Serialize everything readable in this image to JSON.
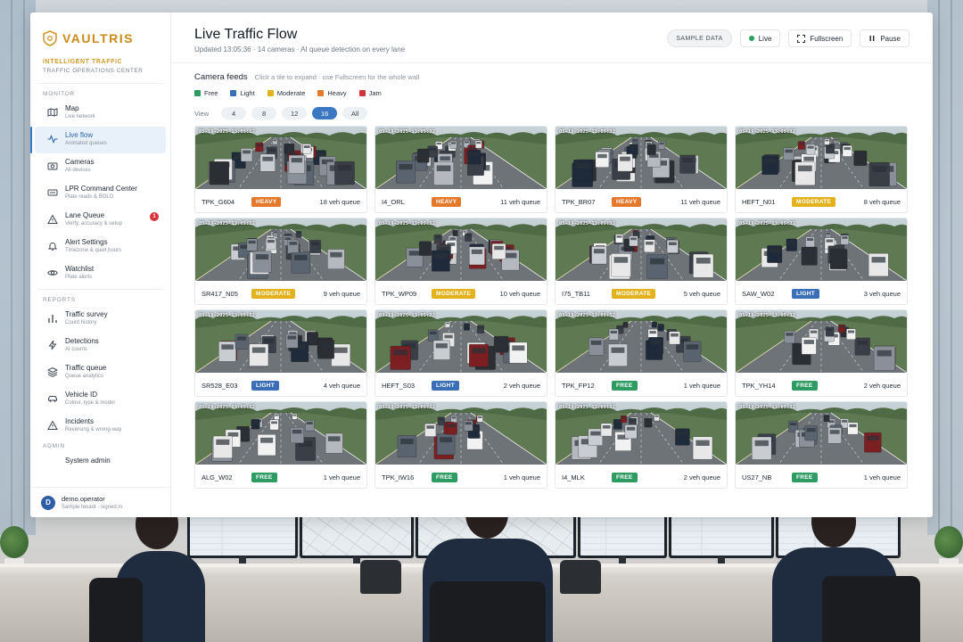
{
  "brand": {
    "name": "VAULTRIS",
    "org_line1": "INTELLIGENT TRAFFIC",
    "org_line2": "TRAFFIC OPERATIONS CENTER"
  },
  "nav": {
    "monitor_title": "MONITOR",
    "monitor": [
      {
        "label": "Map",
        "sub": "Live network",
        "icon": "map-icon"
      },
      {
        "label": "Live flow",
        "sub": "Animated queues",
        "icon": "pulse-icon",
        "active": true
      },
      {
        "label": "Cameras",
        "sub": "All devices",
        "icon": "camera-icon"
      },
      {
        "label": "LPR Command Center",
        "sub": "Plate reads & BOLO",
        "icon": "plate-icon"
      },
      {
        "label": "Lane Queue",
        "sub": "Verify, accuracy & setup",
        "icon": "warning-icon",
        "badge": "1"
      },
      {
        "label": "Alert Settings",
        "sub": "Timezone & quiet hours",
        "icon": "bell-icon"
      },
      {
        "label": "Watchlist",
        "sub": "Plate alerts",
        "icon": "eye-icon"
      }
    ],
    "reports_title": "REPORTS",
    "reports": [
      {
        "label": "Traffic survey",
        "sub": "Count history",
        "icon": "bar-chart-icon"
      },
      {
        "label": "Detections",
        "sub": "AI counts",
        "icon": "bolt-icon"
      },
      {
        "label": "Traffic queue",
        "sub": "Queue analytics",
        "icon": "layers-icon"
      },
      {
        "label": "Vehicle ID",
        "sub": "Colour, type & model",
        "icon": "car-icon"
      },
      {
        "label": "Incidents",
        "sub": "Reversing & wrong-way",
        "icon": "alert-icon"
      }
    ],
    "admin_title": "ADMIN",
    "admin": [
      {
        "label": "System admin",
        "icon": "gear-icon"
      }
    ]
  },
  "user": {
    "initial": "D",
    "name": "demo.operator",
    "sub": "Sample tenant · signed in"
  },
  "header": {
    "title": "Live Traffic Flow",
    "subtitle": "Updated 13:05:36 · 14 cameras · AI queue detection on every lane",
    "sample_label": "SAMPLE DATA",
    "live_label": "Live",
    "fullscreen_label": "Fullscreen",
    "pause_label": "Pause"
  },
  "feeds": {
    "title": "Camera feeds",
    "hint": "Click a tile to expand · use Fullscreen for the whole wall",
    "legend": [
      {
        "label": "Free",
        "color": "#2e9b63"
      },
      {
        "label": "Light",
        "color": "#3a6fb8"
      },
      {
        "label": "Moderate",
        "color": "#e4b21d"
      },
      {
        "label": "Heavy",
        "color": "#e5792b"
      },
      {
        "label": "Jam",
        "color": "#d3343a"
      }
    ],
    "view_label": "View",
    "view_options": [
      "4",
      "8",
      "12",
      "16",
      "All"
    ],
    "view_selected": "16"
  },
  "status_colors": {
    "HEAVY": "#e5792b",
    "MODERATE": "#e4b21d",
    "LIGHT": "#3a6fb8",
    "FREE": "#2e9b63"
  },
  "tiles": [
    {
      "id": "TPK_G604",
      "status": "HEAVY",
      "queue": "18 veh queue",
      "timestamp": "05-19-2025 13:05:32"
    },
    {
      "id": "I4_ORL",
      "status": "HEAVY",
      "queue": "11 veh queue",
      "timestamp": "05-19-2025 13:05:32"
    },
    {
      "id": "TPK_BR07",
      "status": "HEAVY",
      "queue": "11 veh queue",
      "timestamp": "05-19-2025 13:05:32"
    },
    {
      "id": "HEFT_N01",
      "status": "MODERATE",
      "queue": "8 veh queue",
      "timestamp": "05-19-2025 13:05:32"
    },
    {
      "id": "SR417_N05",
      "status": "MODERATE",
      "queue": "9 veh queue",
      "timestamp": "05-19-2025 13:05:32"
    },
    {
      "id": "TPK_WP09",
      "status": "MODERATE",
      "queue": "10 veh queue",
      "timestamp": "05-19-2025 13:05:32"
    },
    {
      "id": "I75_TB11",
      "status": "MODERATE",
      "queue": "5 veh queue",
      "timestamp": "05-19-2025 13:05:32"
    },
    {
      "id": "SAW_W02",
      "status": "LIGHT",
      "queue": "3 veh queue",
      "timestamp": "05-19-2025 13:05:32"
    },
    {
      "id": "SR528_E03",
      "status": "LIGHT",
      "queue": "4 veh queue",
      "timestamp": "05-19-2025 13:05:32"
    },
    {
      "id": "HEFT_S03",
      "status": "LIGHT",
      "queue": "2 veh queue",
      "timestamp": "05-19-2025 13:05:32"
    },
    {
      "id": "TPK_FP12",
      "status": "FREE",
      "queue": "1 veh queue",
      "timestamp": "05-19-2025 13:05:32"
    },
    {
      "id": "TPK_YH14",
      "status": "FREE",
      "queue": "2 veh queue",
      "timestamp": "05-19-2025 13:05:32"
    },
    {
      "id": "ALG_W02",
      "status": "FREE",
      "queue": "1 veh queue",
      "timestamp": "05-19-2025 13:05:32"
    },
    {
      "id": "TPK_IW16",
      "status": "FREE",
      "queue": "1 veh queue",
      "timestamp": "05-19-2025 13:05:32"
    },
    {
      "id": "I4_MLK",
      "status": "FREE",
      "queue": "2 veh queue",
      "timestamp": "05-19-2025 13:05:32"
    },
    {
      "id": "US27_NB",
      "status": "FREE",
      "queue": "1 veh queue",
      "timestamp": "05-19-2025 13:05:32"
    }
  ]
}
